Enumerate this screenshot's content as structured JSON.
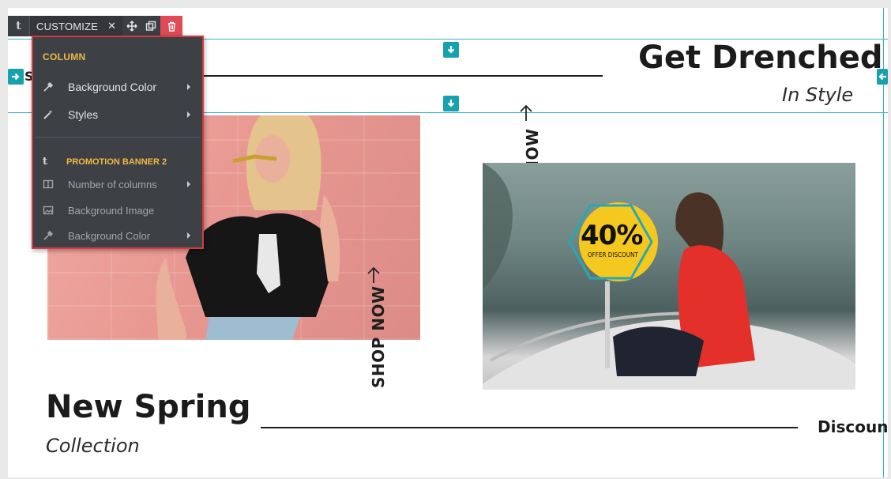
{
  "toolbar": {
    "logo_glyph": "t",
    "customize_label": "CUSTOMIZE",
    "close_glyph": "✕",
    "move_icon": "move-icon",
    "duplicate_icon": "duplicate-icon",
    "delete_icon": "trash-icon",
    "delete_color": "#e04b57"
  },
  "menu": {
    "column_section": "COLUMN",
    "column_items": [
      {
        "label": "Background Color",
        "icon": "eyedropper-icon",
        "has_submenu": true
      },
      {
        "label": "Styles",
        "icon": "magic-wand-icon",
        "has_submenu": true
      }
    ],
    "banner_logo_glyph": "t",
    "banner_section": "PROMOTION BANNER 2",
    "banner_items": [
      {
        "label": "Number of columns",
        "icon": "columns-icon",
        "has_submenu": true
      },
      {
        "label": "Background Image",
        "icon": "image-icon",
        "has_submenu": false
      },
      {
        "label": "Background Color",
        "icon": "eyedropper-icon",
        "has_submenu": true
      }
    ],
    "border_color": "#d63a43",
    "section_color": "#f1b946"
  },
  "page": {
    "headline_right": "Get Drenched",
    "subline_right": "In Style",
    "headline_left": "New Spring",
    "subline_left": "Collection",
    "shop_now_1": "SHOP NOW",
    "shop_now_2": "SHOP NOW",
    "discount_text": "Discount",
    "left_edge_partial": "S",
    "badge_percent": "40%",
    "badge_caption": "OFFER DISCOUNT",
    "badge_color": "#f5c81f",
    "guide_color": "#39b3c3",
    "drop_arrow_color": "#17a0ae"
  }
}
